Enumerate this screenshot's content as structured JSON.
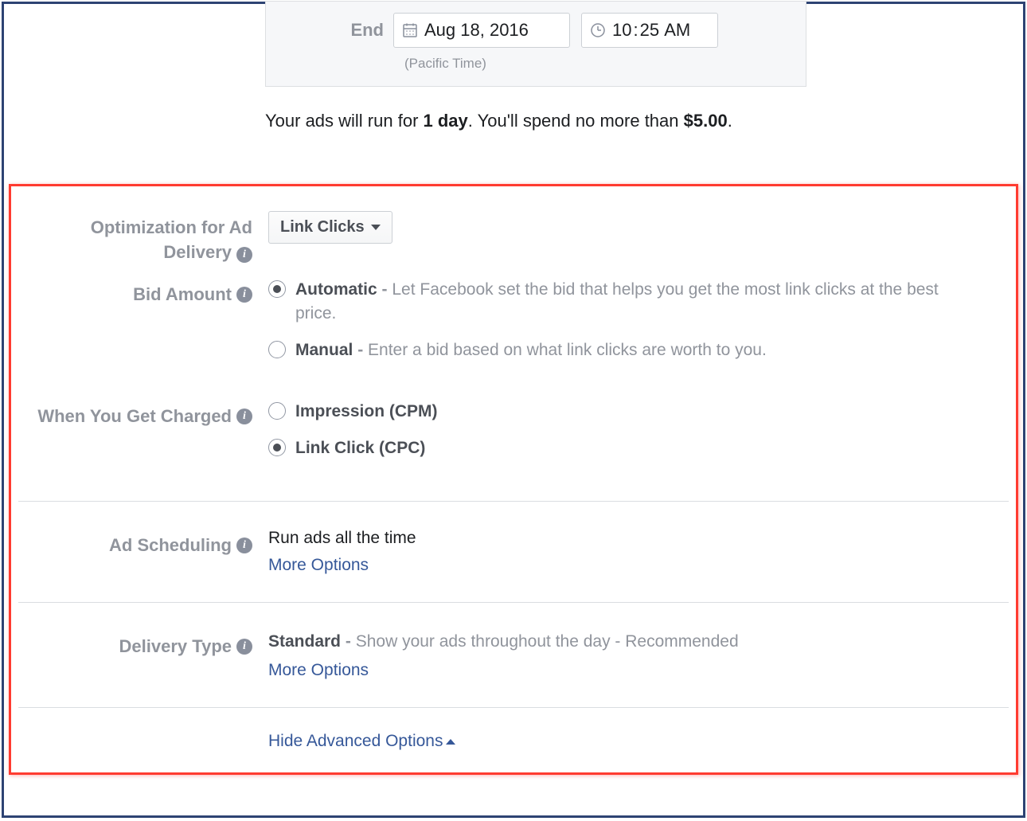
{
  "schedule": {
    "end_label": "End",
    "date": "Aug 18, 2016",
    "time_hour": "10",
    "time_colon": ":",
    "time_minute": "25",
    "time_ampm": "AM",
    "timezone": "(Pacific Time)"
  },
  "summary": {
    "prefix": "Your ads will run for ",
    "duration_bold": "1 day",
    "middle": ". You'll spend no more than ",
    "amount_bold": "$5.00",
    "suffix": "."
  },
  "optimization": {
    "label_line1": "Optimization for Ad",
    "label_line2": "Delivery",
    "selected": "Link Clicks"
  },
  "bid": {
    "label": "Bid Amount",
    "options": [
      {
        "title": "Automatic",
        "desc": "Let Facebook set the bid that helps you get the most link clicks at the best price.",
        "checked": true
      },
      {
        "title": "Manual",
        "desc": "Enter a bid based on what link clicks are worth to you.",
        "checked": false
      }
    ]
  },
  "charged": {
    "label": "When You Get Charged",
    "options": [
      {
        "title": "Impression (CPM)",
        "checked": false
      },
      {
        "title": "Link Click (CPC)",
        "checked": true
      }
    ]
  },
  "scheduling": {
    "label": "Ad Scheduling",
    "value": "Run ads all the time",
    "more": "More Options"
  },
  "delivery": {
    "label": "Delivery Type",
    "title": "Standard",
    "desc": "Show your ads throughout the day - Recommended",
    "more": "More Options"
  },
  "hide_advanced": "Hide Advanced Options"
}
